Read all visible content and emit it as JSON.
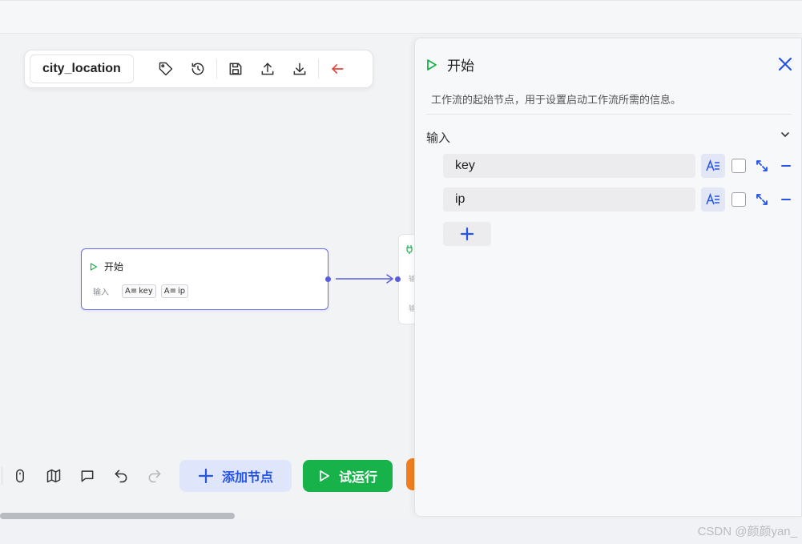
{
  "workflow": {
    "name": "city_location"
  },
  "toolbar": {
    "icons": [
      "tag-icon",
      "history-icon",
      "save-icon",
      "upload-icon",
      "download-icon",
      "back-arrow-icon"
    ]
  },
  "canvas": {
    "start_node": {
      "title": "开始",
      "input_label": "输入",
      "chips": [
        {
          "type_icon": "A≡",
          "label": "key"
        },
        {
          "type_icon": "A≡",
          "label": "ip"
        }
      ]
    },
    "next_node": {
      "icon": "plug-icon",
      "text": [
        "输",
        "输"
      ]
    }
  },
  "bottom_toolbar": {
    "icons": [
      "mouse-icon",
      "map-icon",
      "comment-icon",
      "undo-icon",
      "redo-icon"
    ],
    "add_node_label": "添加节点",
    "run_label": "试运行"
  },
  "panel": {
    "title": "开始",
    "description": "工作流的起始节点，用于设置启动工作流所需的信息。",
    "section_label": "输入",
    "fields": [
      {
        "name": "key"
      },
      {
        "name": "ip"
      }
    ]
  },
  "colors": {
    "accent_blue": "#2454e8",
    "start_green": "#17b24a",
    "node_border": "#6a6cf0",
    "back_arrow_red": "#e8443a"
  },
  "watermark": "CSDN @颜颜yan_"
}
